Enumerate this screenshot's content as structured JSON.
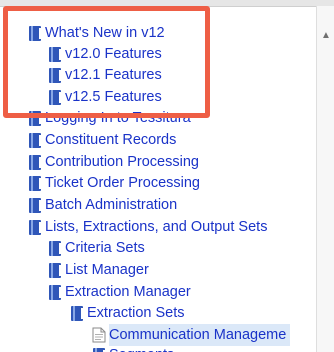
{
  "tree": {
    "items": [
      {
        "label": "What's New in v12"
      },
      {
        "label": "v12.0 Features"
      },
      {
        "label": "v12.1 Features"
      },
      {
        "label": "v12.5 Features"
      },
      {
        "label": "Logging In to Tessitura"
      },
      {
        "label": "Constituent Records"
      },
      {
        "label": "Contribution Processing"
      },
      {
        "label": "Ticket Order Processing"
      },
      {
        "label": "Batch Administration"
      },
      {
        "label": "Lists, Extractions, and Output Sets"
      },
      {
        "label": "Criteria Sets"
      },
      {
        "label": "List Manager"
      },
      {
        "label": "Extraction Manager"
      },
      {
        "label": "Extraction Sets"
      },
      {
        "label": "Communication Manageme"
      },
      {
        "label": "Segments"
      }
    ]
  },
  "colors": {
    "link": "#1a33c8",
    "book_icon": "#2f56b8",
    "highlight": "#ee5e45",
    "selected_background": "#dbe8f8"
  }
}
